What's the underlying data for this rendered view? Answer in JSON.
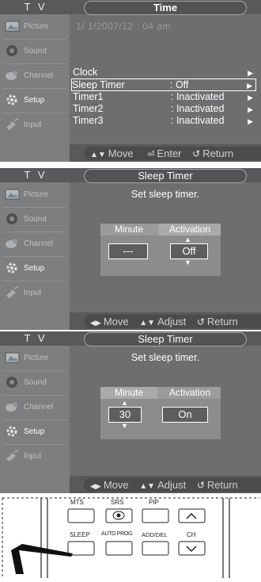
{
  "screens": [
    {
      "tv_label": "T V",
      "title": "Time",
      "datetime": "1/ 1/2007/12 : 04  am",
      "sidebar": [
        "Picture",
        "Sound",
        "Channel",
        "Setup",
        "Input"
      ],
      "menu": [
        {
          "label": "Clock",
          "value": ""
        },
        {
          "label": "Sleep Timer",
          "value": ": Off"
        },
        {
          "label": "Timer1",
          "value": ": Inactivated"
        },
        {
          "label": "Timer2",
          "value": ": Inactivated"
        },
        {
          "label": "Timer3",
          "value": ": Inactivated"
        }
      ],
      "footer": {
        "move": "Move",
        "enter": "Enter",
        "return": "Return"
      }
    },
    {
      "tv_label": "T V",
      "title": "Sleep Timer",
      "prompt": "Set sleep timer.",
      "sidebar": [
        "Picture",
        "Sound",
        "Channel",
        "Setup",
        "Input"
      ],
      "minute_header": "Minute",
      "activation_header": "Activation",
      "minute_value": "---",
      "activation_value": "Off",
      "footer": {
        "move": "Move",
        "adjust": "Adjust",
        "return": "Return"
      }
    },
    {
      "tv_label": "T V",
      "title": "Sleep Timer",
      "prompt": "Set sleep timer.",
      "sidebar": [
        "Picture",
        "Sound",
        "Channel",
        "Setup",
        "Input"
      ],
      "minute_header": "Minute",
      "activation_header": "Activation",
      "minute_value": "30",
      "activation_value": "On",
      "footer": {
        "move": "Move",
        "adjust": "Adjust",
        "return": "Return"
      }
    }
  ],
  "remote": {
    "top_labels": [
      "MTS",
      "SRS",
      "PIP"
    ],
    "bottom_labels": [
      "SLEEP",
      "AUTO PROG.",
      "ADD/DEL",
      "CH"
    ]
  }
}
